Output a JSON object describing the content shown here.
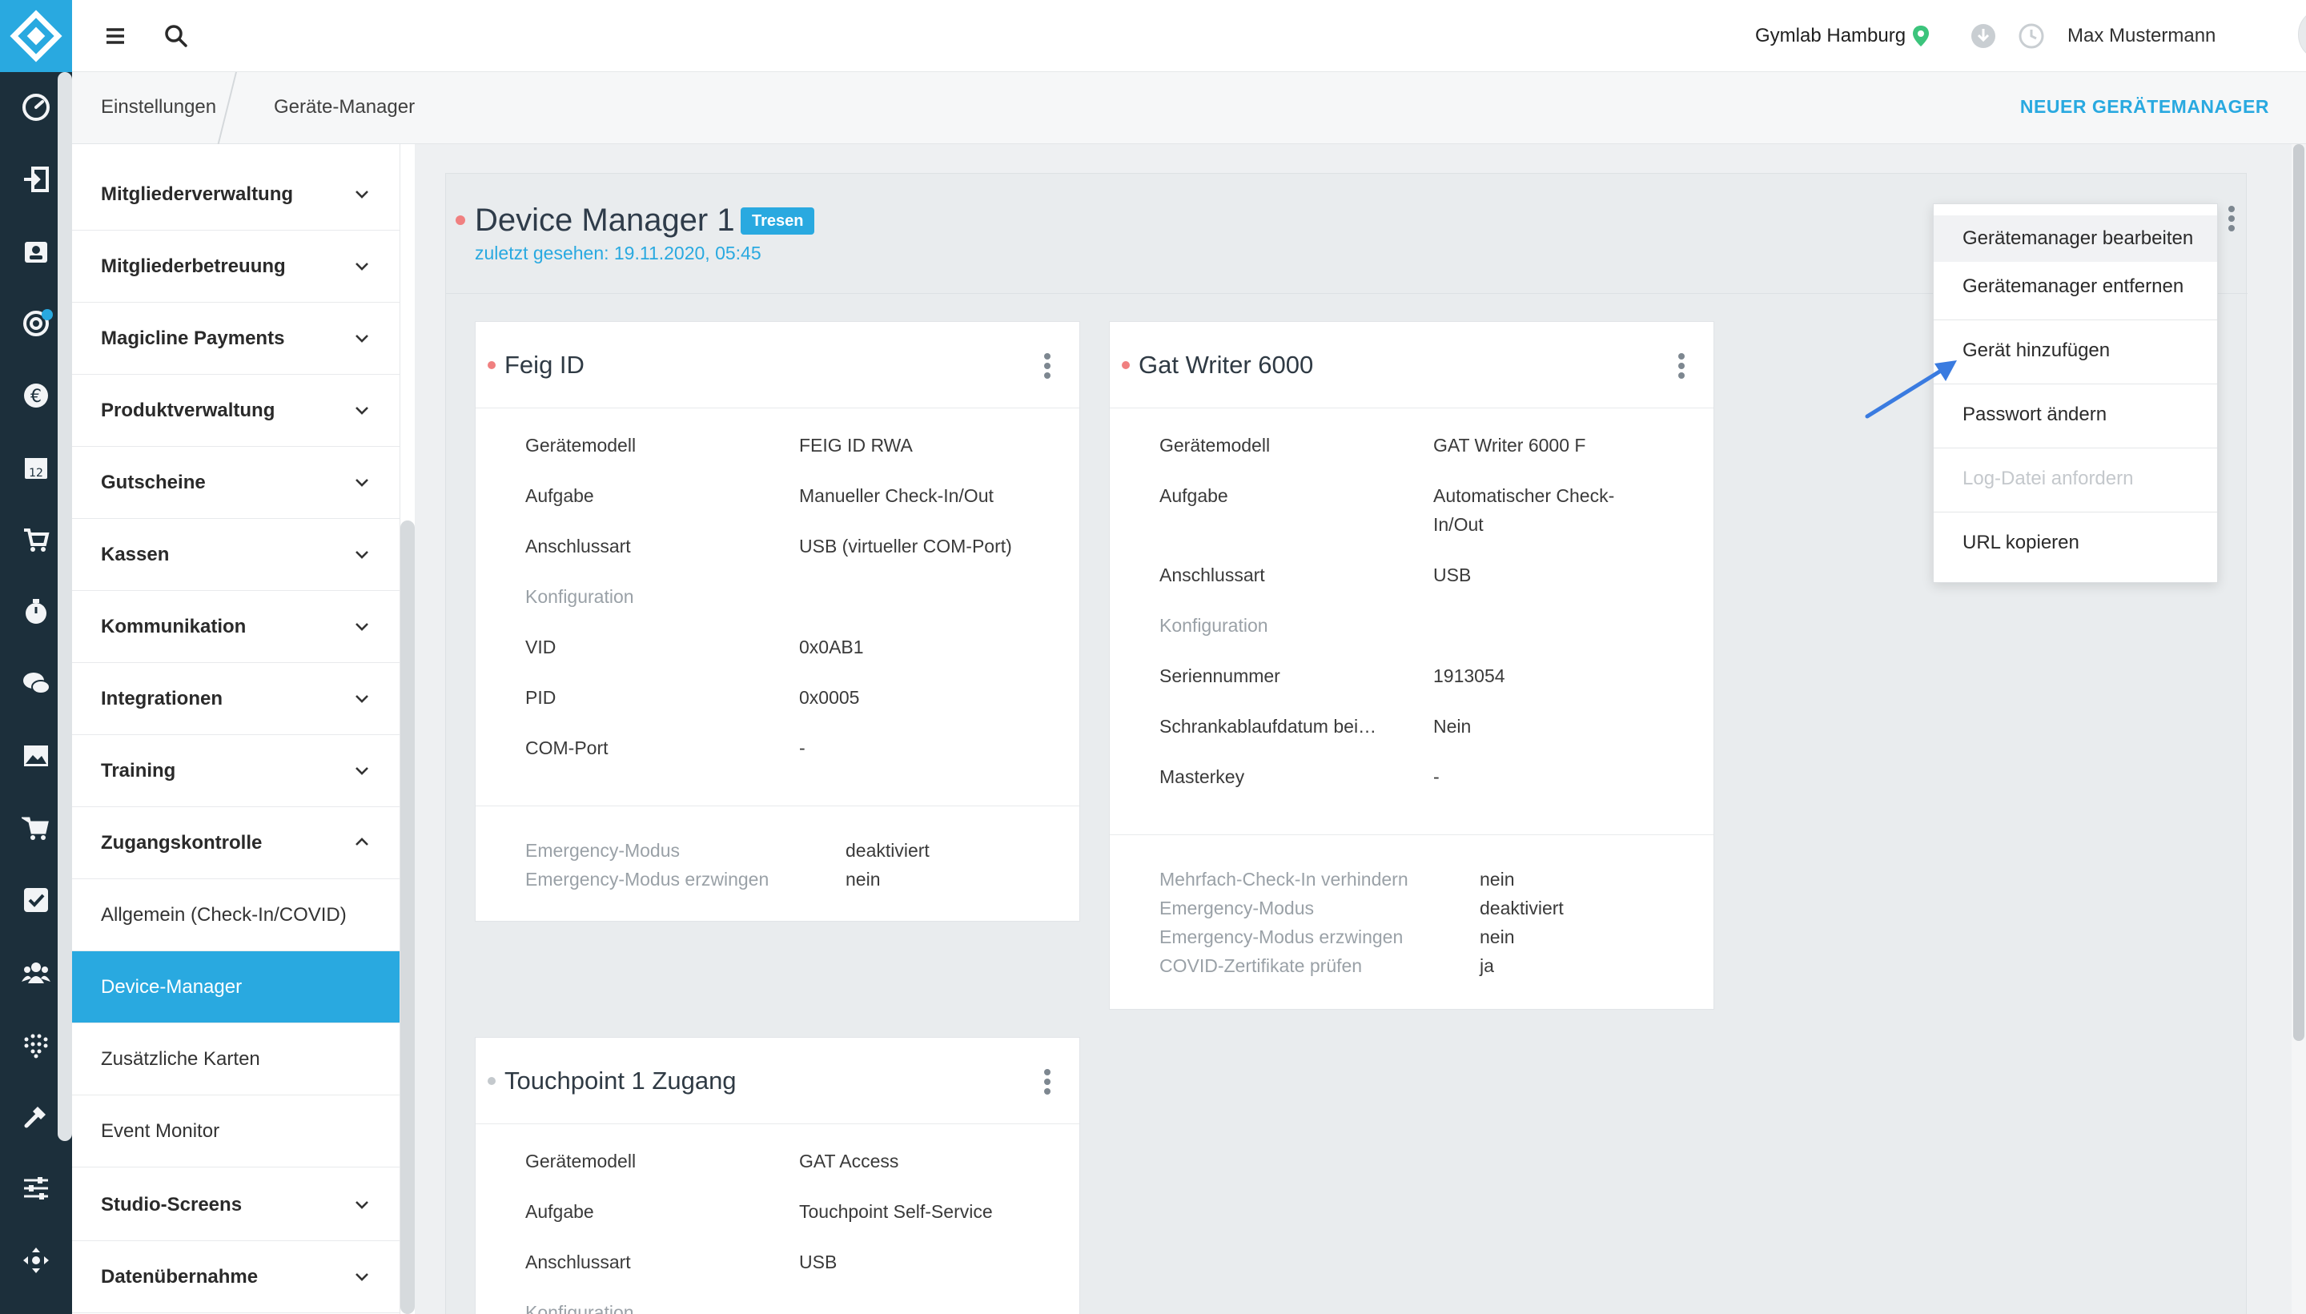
{
  "topbar": {
    "location": "Gymlab Hamburg",
    "user_name": "Max Mustermann"
  },
  "breadcrumb": {
    "items": [
      "Einstellungen",
      "Geräte-Manager"
    ],
    "action_label": "NEUER GERÄTEMANAGER"
  },
  "sidebar": {
    "items": [
      {
        "label": "Mitgliederverwaltung"
      },
      {
        "label": "Mitgliederbetreuung"
      },
      {
        "label": "Magicline Payments"
      },
      {
        "label": "Produktverwaltung"
      },
      {
        "label": "Gutscheine"
      },
      {
        "label": "Kassen"
      },
      {
        "label": "Kommunikation"
      },
      {
        "label": "Integrationen"
      },
      {
        "label": "Training"
      },
      {
        "label": "Zugangskontrolle"
      },
      {
        "label": "Allgemein (Check-In/COVID)"
      },
      {
        "label": "Device-Manager"
      },
      {
        "label": "Zusätzliche Karten"
      },
      {
        "label": "Event Monitor"
      },
      {
        "label": "Studio-Screens"
      },
      {
        "label": "Datenübernahme"
      }
    ]
  },
  "device_manager": {
    "title": "Device Manager 1",
    "badge": "Tresen",
    "last_seen": "zuletzt gesehen: 19.11.2020, 05:45"
  },
  "cards": [
    {
      "title": "Feig ID",
      "rows": [
        {
          "label": "Gerätemodell",
          "value": "FEIG ID RWA"
        },
        {
          "label": "Aufgabe",
          "value": "Manueller Check-In/Out"
        },
        {
          "label": "Anschlussart",
          "value": "USB (virtueller COM-Port)"
        },
        {
          "label": "Konfiguration",
          "value": ""
        },
        {
          "label": "VID",
          "value": "0x0AB1"
        },
        {
          "label": "PID",
          "value": "0x0005"
        },
        {
          "label": "COM-Port",
          "value": "-"
        }
      ],
      "footer": [
        {
          "label": "Emergency-Modus",
          "value": "deaktiviert"
        },
        {
          "label": "Emergency-Modus erzwingen",
          "value": "nein"
        }
      ]
    },
    {
      "title": "Gat Writer 6000",
      "rows": [
        {
          "label": "Gerätemodell",
          "value": "GAT Writer 6000 F"
        },
        {
          "label": "Aufgabe",
          "value": "Automatischer Check-",
          "value2": "In/Out"
        },
        {
          "label": "Anschlussart",
          "value": "USB"
        },
        {
          "label": "Konfiguration",
          "value": ""
        },
        {
          "label": "Seriennummer",
          "value": "1913054"
        },
        {
          "label": "Schrankablaufdatum bei…",
          "value": "Nein"
        },
        {
          "label": "Masterkey",
          "value": "-"
        }
      ],
      "footer": [
        {
          "label": "Mehrfach-Check-In verhindern",
          "value": "nein"
        },
        {
          "label": "Emergency-Modus",
          "value": "deaktiviert"
        },
        {
          "label": "Emergency-Modus erzwingen",
          "value": "nein"
        },
        {
          "label": "COVID-Zertifikate prüfen",
          "value": "ja"
        }
      ]
    },
    {
      "title": "Touchpoint 1 Zugang",
      "rows": [
        {
          "label": "Gerätemodell",
          "value": "GAT Access"
        },
        {
          "label": "Aufgabe",
          "value": "Touchpoint Self-Service"
        },
        {
          "label": "Anschlussart",
          "value": "USB"
        },
        {
          "label": "Konfiguration",
          "value": ""
        }
      ]
    }
  ],
  "dropdown": {
    "items": [
      {
        "label": "Gerätemanager bearbeiten",
        "state": "hover"
      },
      {
        "label": "Gerätemanager entfernen",
        "state": "normal"
      },
      {
        "label": "Gerät hinzufügen",
        "state": "normal"
      },
      {
        "label": "Passwort ändern",
        "state": "normal"
      },
      {
        "label": "Log-Datei anfordern",
        "state": "disabled"
      },
      {
        "label": "URL kopieren",
        "state": "normal"
      }
    ]
  },
  "colors": {
    "accent": "#29a9e0",
    "rail": "#1c2f3b",
    "status_offline": "#f08080",
    "location_pin": "#3cc47c",
    "annotation_arrow": "#3a7be0"
  }
}
